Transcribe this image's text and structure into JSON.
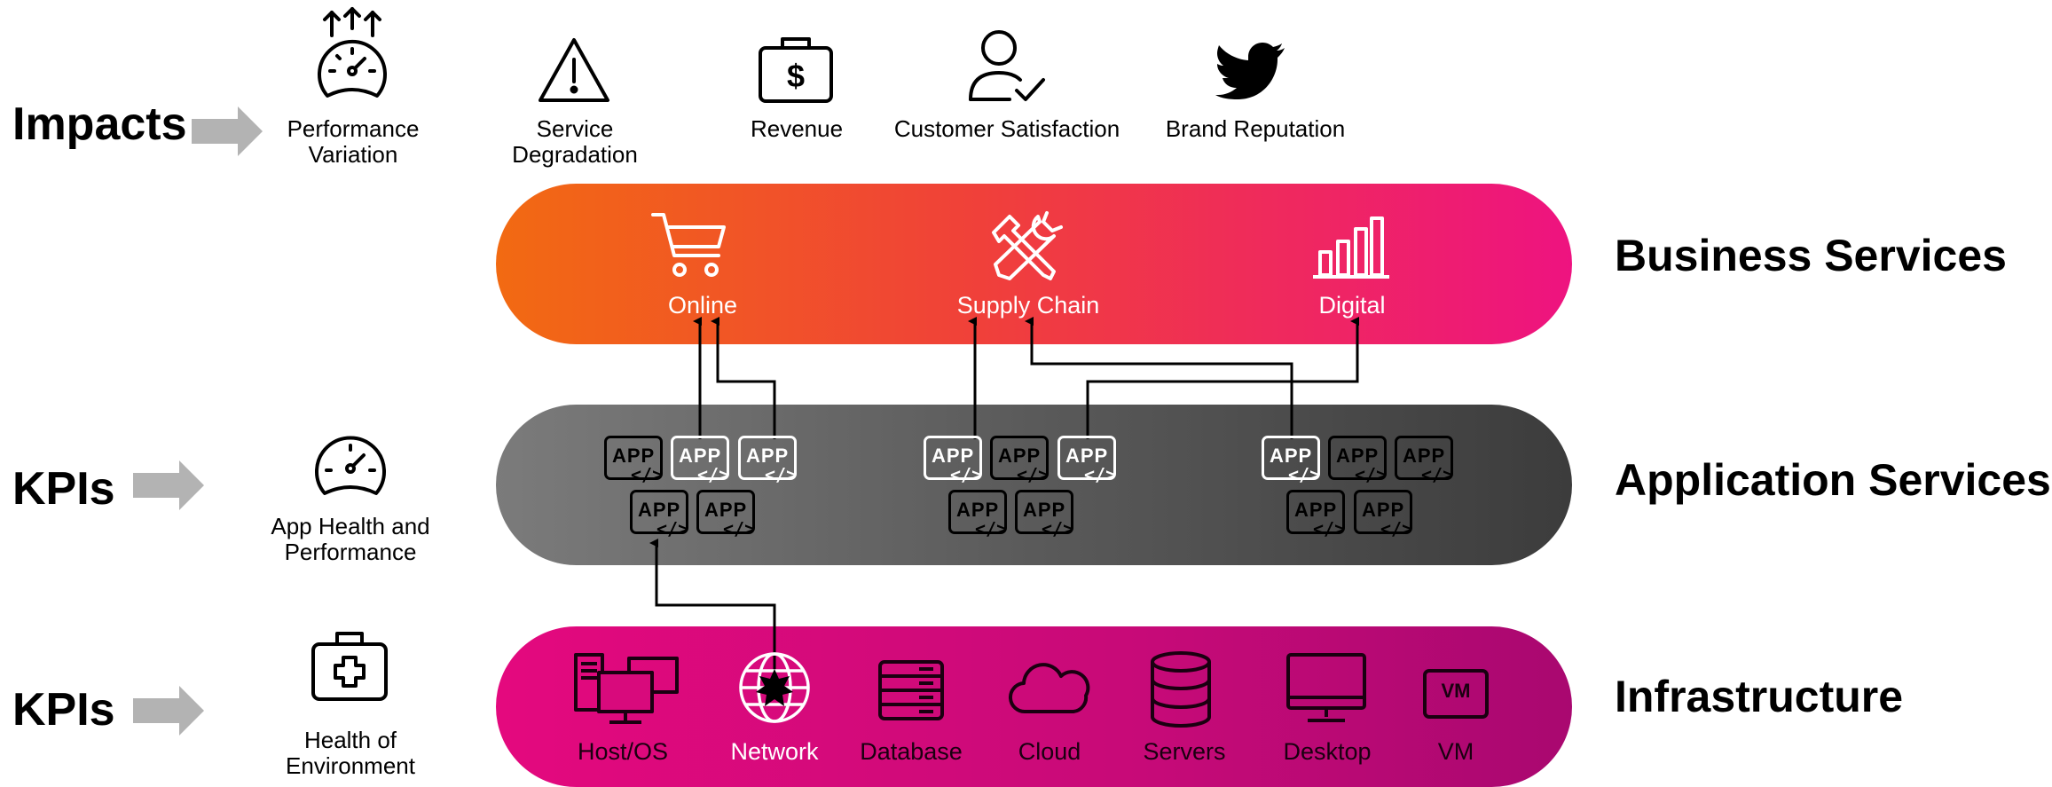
{
  "rows": {
    "impacts_label": "Impacts",
    "kpi_app_label": "KPIs",
    "kpi_infra_label": "KPIs"
  },
  "impacts": [
    {
      "label": "Performance\nVariation",
      "icon": "speedometer-up-icon"
    },
    {
      "label": "Service\nDegradation",
      "icon": "warning-triangle-icon"
    },
    {
      "label": "Revenue",
      "icon": "dollar-briefcase-icon"
    },
    {
      "label": "Customer Satisfaction",
      "icon": "user-check-icon"
    },
    {
      "label": "Brand Reputation",
      "icon": "twitter-bird-icon"
    }
  ],
  "kpis": {
    "app": "App Health and\nPerformance",
    "infra": "Health of\nEnvironment"
  },
  "bands": {
    "business": {
      "title": "Business Services",
      "items": [
        {
          "label": "Online",
          "icon": "shopping-cart-icon"
        },
        {
          "label": "Supply Chain",
          "icon": "tools-icon"
        },
        {
          "label": "Digital",
          "icon": "bar-chart-icon"
        }
      ]
    },
    "application": {
      "title": "Application Services",
      "app_label": "APP",
      "code_label": "</>"
    },
    "infrastructure": {
      "title": "Infrastructure",
      "items": [
        {
          "label": "Host/OS",
          "icon": "computers-icon"
        },
        {
          "label": "Network",
          "icon": "globe-icon"
        },
        {
          "label": "Database",
          "icon": "database-rack-icon"
        },
        {
          "label": "Cloud",
          "icon": "cloud-icon"
        },
        {
          "label": "Servers",
          "icon": "server-stack-icon"
        },
        {
          "label": "Desktop",
          "icon": "monitor-icon"
        },
        {
          "label": "VM",
          "icon": "vm-icon"
        }
      ],
      "vm_badge": "VM"
    }
  },
  "colors": {
    "business_start": "#f26a12",
    "business_end": "#ee1380",
    "application_start": "#7b7b7b",
    "application_end": "#3c3c3c",
    "infra_start": "#e4097e",
    "infra_end": "#a90870",
    "arrow_gray": "#b3b3b3"
  }
}
